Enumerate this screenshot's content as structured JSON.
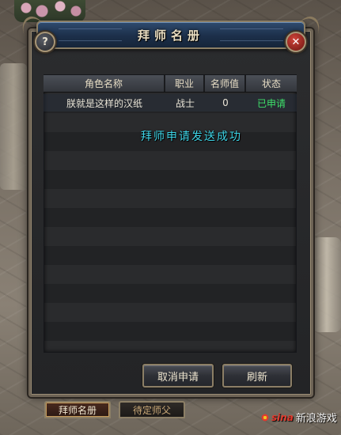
{
  "window": {
    "title": "拜师名册",
    "help_icon": "?",
    "close_icon": "✕"
  },
  "table": {
    "columns": [
      "角色名称",
      "职业",
      "名师值",
      "状态"
    ],
    "rows": [
      {
        "name": "朕就是这样的汉纸",
        "class": "战士",
        "mentor_value": "0",
        "status": "已申请"
      }
    ]
  },
  "notice": "拜师申请发送成功",
  "buttons": {
    "cancel": "取消申请",
    "refresh": "刷新"
  },
  "tabs": [
    {
      "label": "拜师名册",
      "active": true
    },
    {
      "label": "待定师父",
      "active": false
    }
  ],
  "watermark": {
    "brand": "sina",
    "text": "新浪游戏"
  },
  "colors": {
    "status_applied": "#3ee06a",
    "notice": "#3fd6e8",
    "title_bar": "#2f4b6e"
  }
}
